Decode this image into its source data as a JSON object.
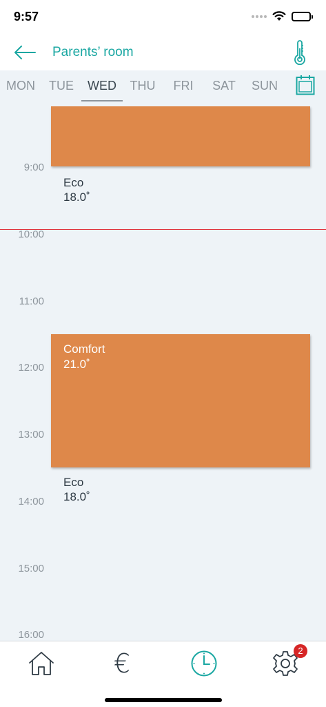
{
  "status_bar": {
    "time": "9:57"
  },
  "header": {
    "title": "Parents’ room"
  },
  "day_tabs": [
    {
      "label": "MON",
      "active": false
    },
    {
      "label": "TUE",
      "active": false
    },
    {
      "label": "WED",
      "active": true
    },
    {
      "label": "THU",
      "active": false
    },
    {
      "label": "FRI",
      "active": false
    },
    {
      "label": "SAT",
      "active": false
    },
    {
      "label": "SUN",
      "active": false
    }
  ],
  "schedule": {
    "hours": [
      "9:00",
      "10:00",
      "11:00",
      "12:00",
      "13:00",
      "14:00",
      "15:00",
      "16:00"
    ],
    "blocks": [
      {
        "name": "",
        "temp": ""
      },
      {
        "name": "Comfort",
        "temp": "21.0˚"
      }
    ],
    "periods": [
      {
        "name": "Eco",
        "temp": "18.0˚"
      },
      {
        "name": "Eco",
        "temp": "18.0˚"
      }
    ]
  },
  "bottom_nav": {
    "items": [
      {
        "icon": "home-icon",
        "active": false
      },
      {
        "icon": "euro-icon",
        "active": false,
        "glyph": "€"
      },
      {
        "icon": "clock-icon",
        "active": true
      },
      {
        "icon": "gear-icon",
        "active": false
      }
    ],
    "badge_count": "2"
  },
  "colors": {
    "accent": "#1aa7a2",
    "block": "#de884a",
    "now_line": "#e0303a",
    "schedule_bg": "#eef3f7",
    "badge": "#d62626"
  }
}
